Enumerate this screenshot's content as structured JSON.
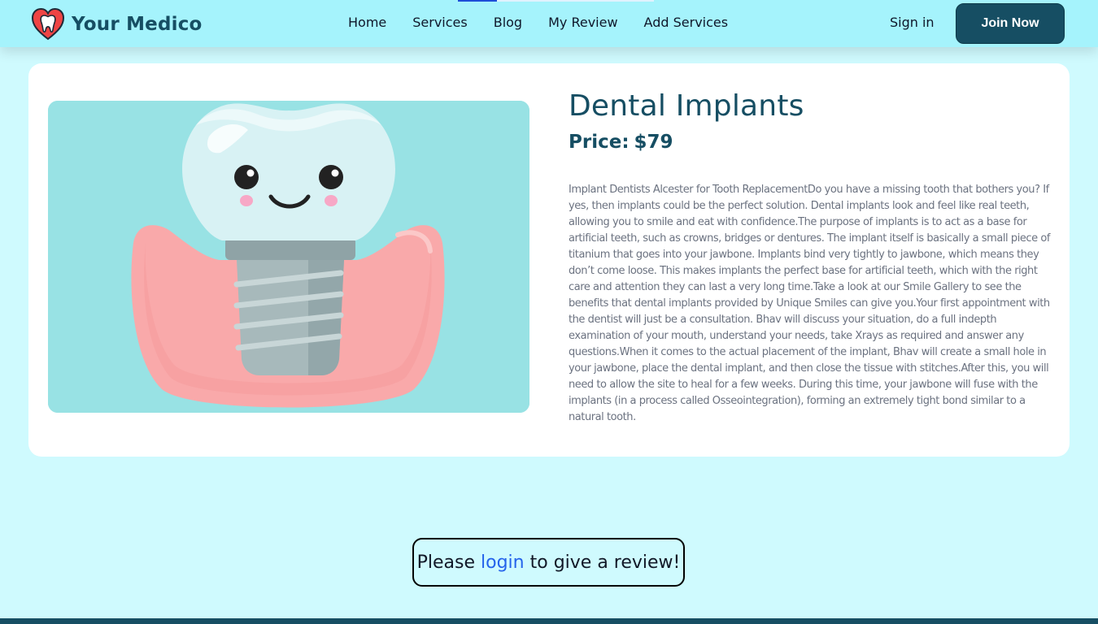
{
  "header": {
    "brand_name": "Your Medico",
    "nav": [
      "Home",
      "Services",
      "Blog",
      "My Review",
      "Add Services"
    ],
    "sign_in": "Sign in",
    "join_now": "Join Now"
  },
  "service": {
    "title": "Dental Implants",
    "price_label": "Price:",
    "price": "$79",
    "description": "Implant Dentists Alcester for Tooth ReplacementDo you have a missing tooth that bothers you? If yes, then implants could be the perfect solution. Dental implants look and feel like real teeth, allowing you to smile and eat with confidence.The purpose of implants is to act as a base for artificial teeth, such as crowns, bridges or dentures. The implant itself is basically a small piece of titanium that goes into your jawbone. Implants bind very tightly to jawbone, which means they don’t come loose. This makes implants the perfect base for artificial teeth, which with the right care and attention they can last a very long time.Take a look at our Smile Gallery to see the benefits that dental implants provided by Unique Smiles can give you.Your first appointment with the dentist will just be a consultation. Bhav will discuss your situation, do a full indepth examination of your mouth, understand your needs, take Xrays as required and answer any questions.When it comes to the actual placement of the implant, Bhav will create a small hole in your jawbone, place the dental implant, and then close the tissue with stitches.After this, you will need to allow the site to heal for a few weeks. During this time, your jawbone will fuse with the implants (in a process called Osseointegration), forming an extremely tight bond similar to a natural tooth."
  },
  "review": {
    "prefix": "Please",
    "login_link": "login",
    "suffix": "to give a review!"
  },
  "colors": {
    "page_background": "#cffafe",
    "header_background": "#a5f3fc",
    "brand_dark": "#164e63",
    "link_blue": "#2563eb"
  },
  "icons": {
    "logo": "heart-tooth-icon"
  }
}
